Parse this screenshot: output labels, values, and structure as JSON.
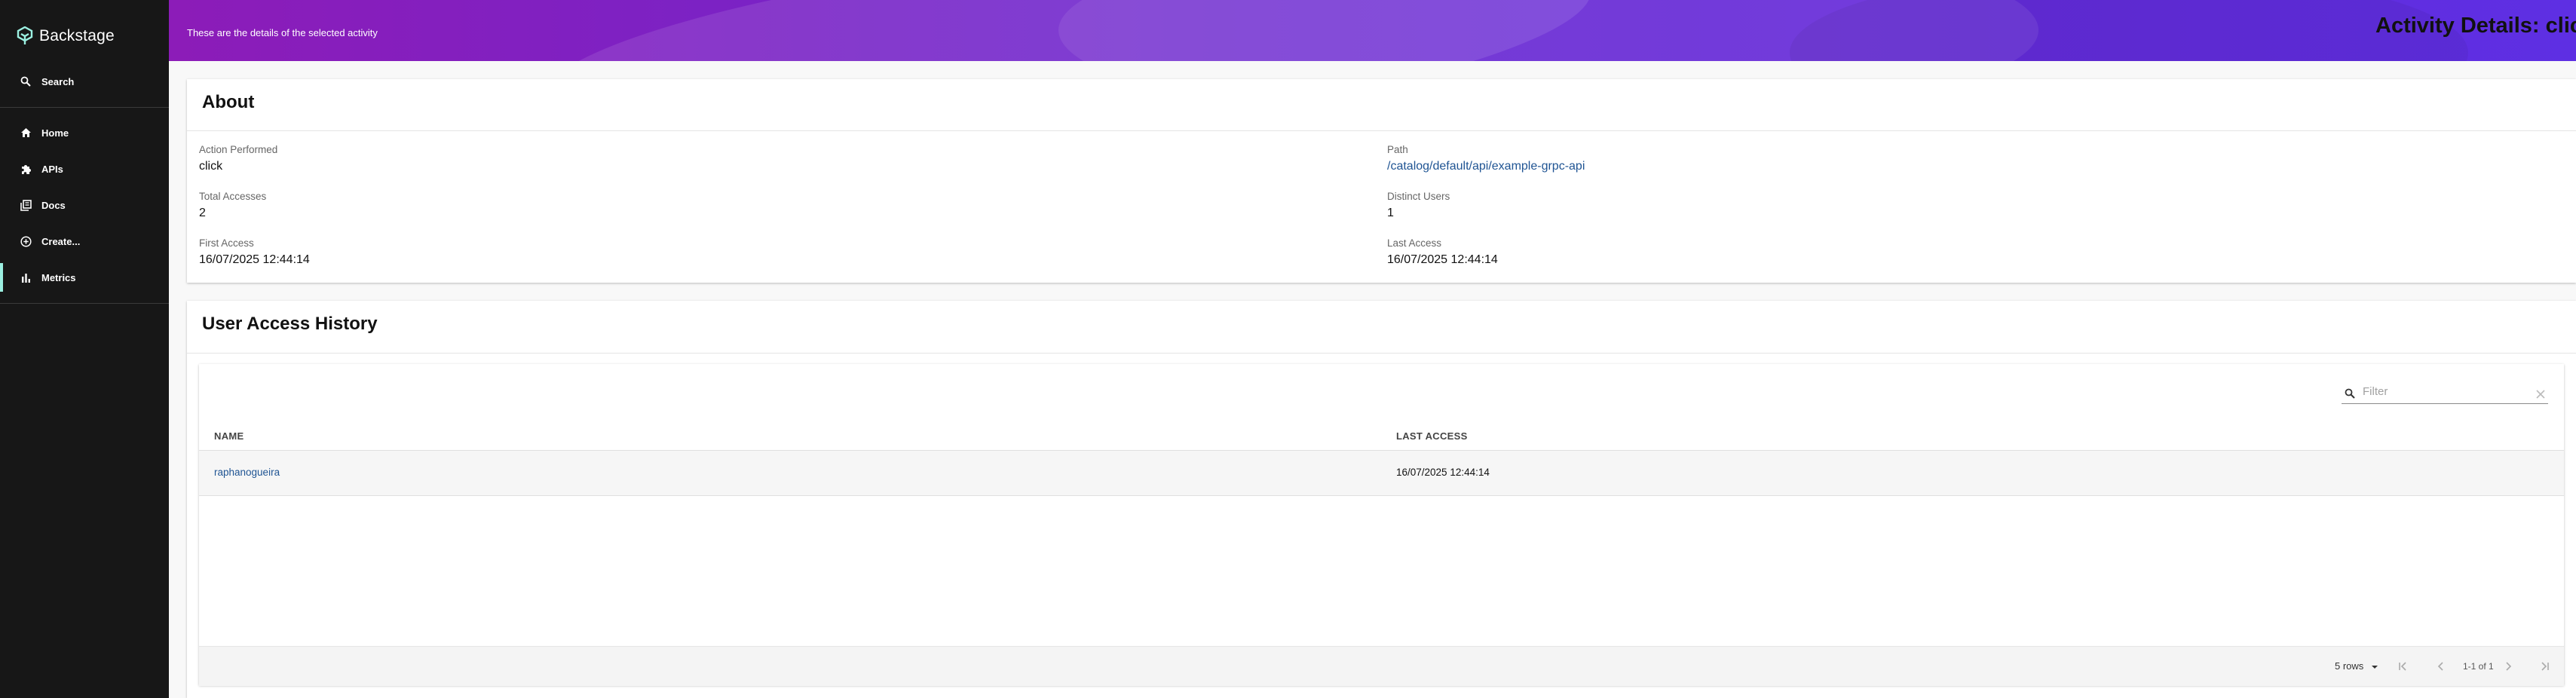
{
  "sidebar": {
    "logo": "Backstage",
    "search_label": "Search",
    "items": [
      {
        "label": "Home",
        "icon": "home-icon"
      },
      {
        "label": "APIs",
        "icon": "puzzle-icon"
      },
      {
        "label": "Docs",
        "icon": "library-icon"
      },
      {
        "label": "Create...",
        "icon": "add-circle-icon"
      },
      {
        "label": "Metrics",
        "icon": "bar-chart-icon",
        "active": true
      }
    ],
    "accent_color": "#9bf0e1"
  },
  "header": {
    "subtitle": "These are the details of the selected activity",
    "title": "Activity Details: click"
  },
  "about": {
    "title": "About",
    "fields": {
      "action_performed": {
        "label": "Action Performed",
        "value": "click"
      },
      "path": {
        "label": "Path",
        "value": "/catalog/default/api/example-grpc-api"
      },
      "total_accesses": {
        "label": "Total Accesses",
        "value": "2"
      },
      "distinct_users": {
        "label": "Distinct Users",
        "value": "1"
      },
      "first_access": {
        "label": "First Access",
        "value": "16/07/2025 12:44:14"
      },
      "last_access": {
        "label": "Last Access",
        "value": "16/07/2025 12:44:14"
      }
    }
  },
  "history": {
    "title": "User Access History",
    "filter_placeholder": "Filter",
    "columns": [
      "NAME",
      "LAST ACCESS"
    ],
    "rows": [
      {
        "name": "raphanogueira",
        "last_access": "16/07/2025 12:44:14"
      }
    ],
    "pagination": {
      "rows_per_page": "5 rows",
      "range": "1-1 of 1"
    }
  }
}
